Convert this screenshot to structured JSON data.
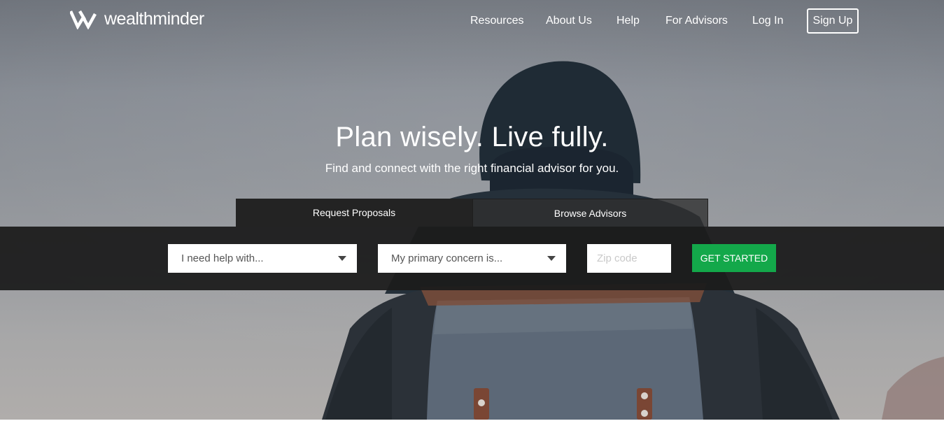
{
  "brand": {
    "name": "wealthminder",
    "icon": "wealthminder-logo-mark"
  },
  "nav": {
    "items": [
      {
        "label": "Resources"
      },
      {
        "label": "About Us"
      },
      {
        "label": "Help"
      },
      {
        "label": "For Advisors"
      },
      {
        "label": "Log In"
      }
    ],
    "signup_label": "Sign Up"
  },
  "hero": {
    "headline": "Plan wisely. Live fully.",
    "subheadline": "Find and connect with the right financial advisor for you."
  },
  "tabs": [
    {
      "label": "Request Proposals",
      "active": true
    },
    {
      "label": "Browse Advisors",
      "active": false
    }
  ],
  "search": {
    "help_select": {
      "value": "I need help with...",
      "icon": "caret-down-icon"
    },
    "concern_select": {
      "value": "My primary concern is...",
      "icon": "caret-down-icon"
    },
    "zip": {
      "value": "",
      "placeholder": "Zip code"
    },
    "cta_label": "GET STARTED"
  },
  "colors": {
    "cta": "#13a84a",
    "search_bar": "#1c1c1c",
    "active_tab": "#232323",
    "text_on_dark": "#ffffff"
  }
}
